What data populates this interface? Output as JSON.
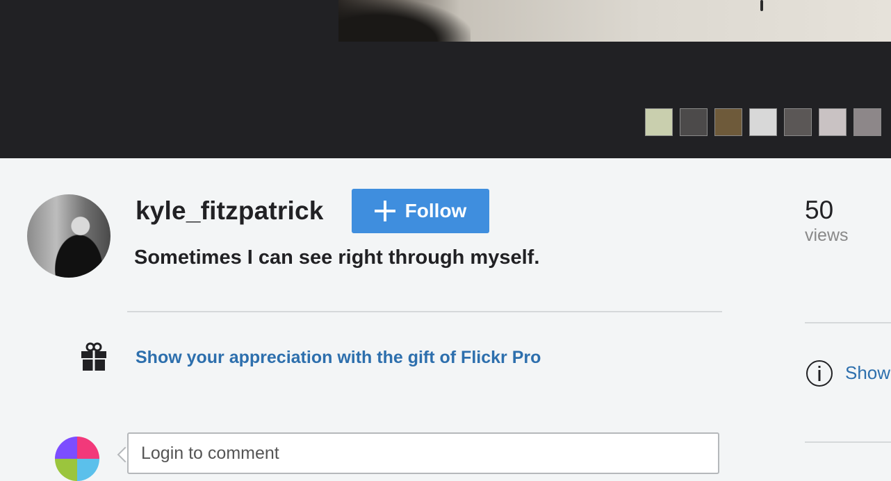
{
  "photo_strip": {
    "thumbnails": [
      {
        "name": "thumbnail-1",
        "color": "#c9cfae"
      },
      {
        "name": "thumbnail-2",
        "color": "#4c4a4a"
      },
      {
        "name": "thumbnail-3",
        "color": "#6e5a3a"
      },
      {
        "name": "thumbnail-4",
        "color": "#d8d8d8"
      },
      {
        "name": "thumbnail-5",
        "color": "#5b5756"
      },
      {
        "name": "thumbnail-6",
        "color": "#c9c2c3"
      },
      {
        "name": "thumbnail-7",
        "color": "#8d8789"
      }
    ]
  },
  "owner": {
    "username": "kyle_fitzpatrick",
    "follow_label": "Follow",
    "follow_icon": "plus-icon"
  },
  "photo": {
    "caption": "Sometimes I can see right through myself."
  },
  "stats": {
    "views_count": "50",
    "views_label": "views"
  },
  "gift": {
    "icon": "gift-icon",
    "link_text": "Show your appreciation with the gift of Flickr Pro"
  },
  "sidebar": {
    "icon": "info-icon",
    "link_text": "Show"
  },
  "comment": {
    "placeholder": "Login to comment"
  },
  "colors": {
    "accent": "#3f8ede",
    "link": "#2d6fad",
    "viewer_bg": "#212124",
    "page_bg": "#f3f5f6"
  }
}
